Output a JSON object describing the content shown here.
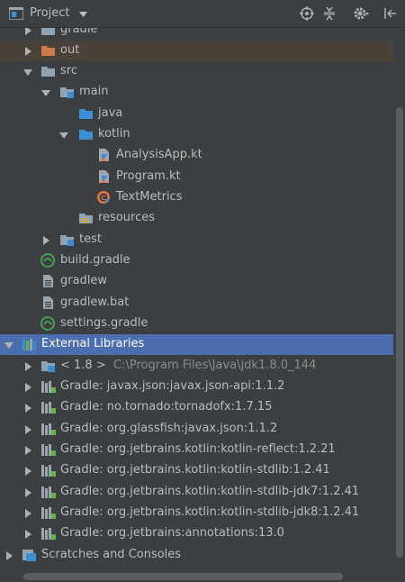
{
  "header": {
    "title": "Project",
    "tools": [
      "locate-icon",
      "collapse-all-icon",
      "settings-icon",
      "hide-icon"
    ]
  },
  "tree": {
    "gradle": "gradle",
    "out": "out",
    "src": "src",
    "main": "main",
    "java": "java",
    "kotlin": "kotlin",
    "analysis_app": "AnalysisApp.kt",
    "program": "Program.kt",
    "text_metrics": "TextMetrics",
    "resources": "resources",
    "test": "test",
    "build_gradle": "build.gradle",
    "gradlew": "gradlew",
    "gradlew_bat": "gradlew.bat",
    "settings_gradle": "settings.gradle",
    "external_libraries": "External Libraries",
    "jdk_version": "< 1.8 >",
    "jdk_path": "C:\\Program Files\\Java\\jdk1.8.0_144",
    "libraries": [
      "Gradle: javax.json:javax.json-api:1.1.2",
      "Gradle: no.tornado:tornadofx:1.7.15",
      "Gradle: org.glassfish:javax.json:1.1.2",
      "Gradle: org.jetbrains.kotlin:kotlin-reflect:1.2.21",
      "Gradle: org.jetbrains.kotlin:kotlin-stdlib:1.2.41",
      "Gradle: org.jetbrains.kotlin:kotlin-stdlib-jdk7:1.2.41",
      "Gradle: org.jetbrains.kotlin:kotlin-stdlib-jdk8:1.2.41",
      "Gradle: org.jetbrains:annotations:13.0"
    ],
    "scratches": "Scratches and Consoles"
  },
  "colors": {
    "background": "#3c3f41",
    "selection": "#4b6eaf",
    "excluded_folder": "#cf7a4b",
    "folder": "#8fa3b3",
    "source_folder": "#3d8fd4",
    "gradle_green": "#499c54"
  }
}
